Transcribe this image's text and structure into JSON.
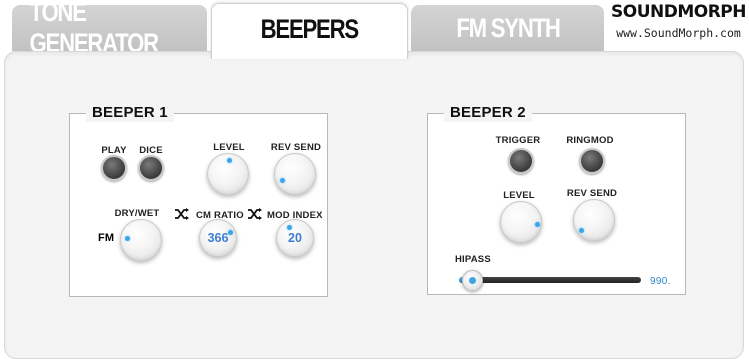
{
  "tabs": [
    {
      "label": "TONE GENERATOR",
      "active": false
    },
    {
      "label": "BEEPERS",
      "active": true
    },
    {
      "label": "FM SYNTH",
      "active": false
    }
  ],
  "logo": {
    "brand": "SOUNDMORPH",
    "url": "www.SoundMorph.com"
  },
  "beeper1": {
    "title": "BEEPER 1",
    "play_label": "PLAY",
    "dice_label": "DICE",
    "level_label": "LEVEL",
    "rev_send_label": "REV SEND",
    "dry_wet_label": "DRY/WET",
    "fm_label": "FM",
    "cm_ratio_label": "CM RATIO",
    "cm_ratio_value": "366",
    "mod_index_label": "MOD INDEX",
    "mod_index_value": "20"
  },
  "beeper2": {
    "title": "BEEPER 2",
    "trigger_label": "TRIGGER",
    "ringmod_label": "RINGMOD",
    "level_label": "LEVEL",
    "rev_send_label": "REV SEND",
    "hipass_label": "HIPASS",
    "hipass_value": "990.",
    "hipass_fraction": 0.04
  },
  "colors": {
    "accent": "#3aa6e6",
    "value_text": "#3c7fd0"
  },
  "icons": [
    "shuffle-icon"
  ]
}
